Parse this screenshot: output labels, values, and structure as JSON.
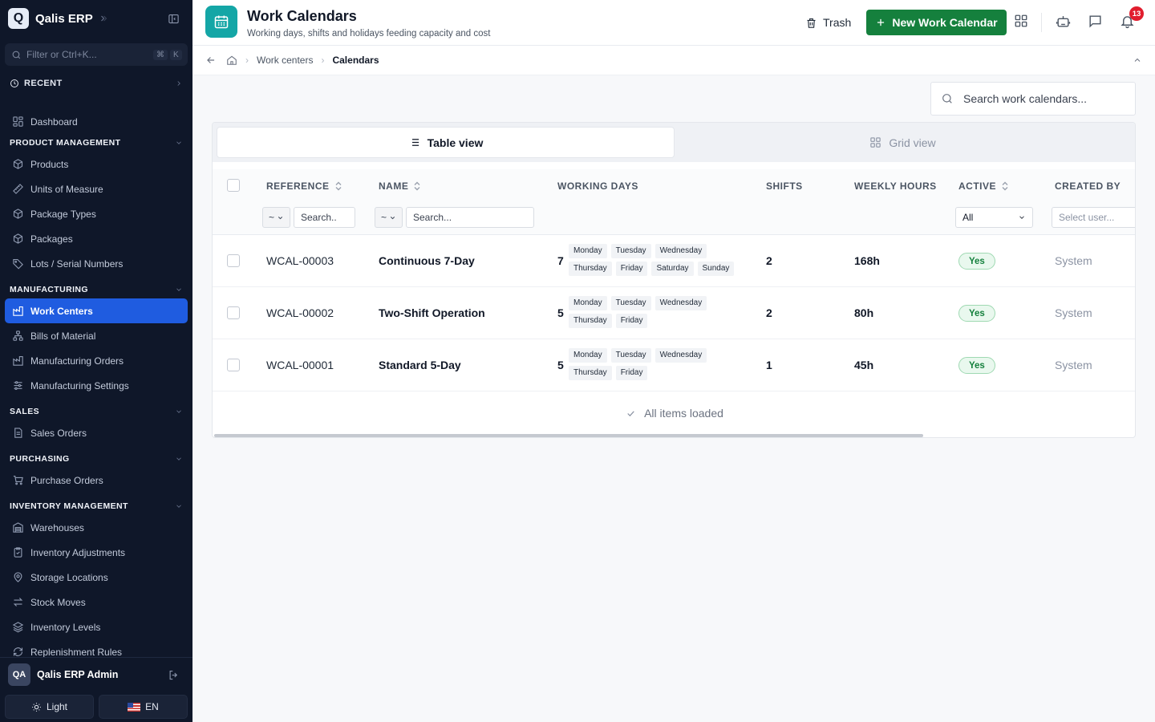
{
  "app": {
    "name": "Qalis ERP",
    "logo_letter": "Q"
  },
  "sidebar": {
    "filter_placeholder": "Filter or Ctrl+K...",
    "filter_keys": [
      "⌘",
      "K"
    ],
    "recent_label": "RECENT",
    "dashboard_label": "Dashboard",
    "sections": [
      {
        "title": "PRODUCT MANAGEMENT",
        "items": [
          "Products",
          "Units of Measure",
          "Package Types",
          "Packages",
          "Lots / Serial Numbers"
        ]
      },
      {
        "title": "MANUFACTURING",
        "items": [
          "Work Centers",
          "Bills of Material",
          "Manufacturing Orders",
          "Manufacturing Settings"
        ]
      },
      {
        "title": "SALES",
        "items": [
          "Sales Orders"
        ]
      },
      {
        "title": "PURCHASING",
        "items": [
          "Purchase Orders"
        ]
      },
      {
        "title": "INVENTORY MANAGEMENT",
        "items": [
          "Warehouses",
          "Inventory Adjustments",
          "Storage Locations",
          "Stock Moves",
          "Inventory Levels",
          "Replenishment Rules"
        ]
      }
    ],
    "active_item": "Work Centers",
    "user": {
      "initials": "QA",
      "name": "Qalis ERP Admin"
    },
    "theme_label": "Light",
    "lang_label": "EN"
  },
  "header": {
    "title": "Work Calendars",
    "subtitle": "Working days, shifts and holidays feeding capacity and cost",
    "trash_label": "Trash",
    "new_label": "New Work Calendar",
    "notification_count": "13"
  },
  "breadcrumb": {
    "items": [
      "Work centers",
      "Calendars"
    ]
  },
  "search": {
    "placeholder": "Search work calendars..."
  },
  "views": {
    "table_label": "Table view",
    "grid_label": "Grid view"
  },
  "table": {
    "columns": [
      "REFERENCE",
      "NAME",
      "WORKING DAYS",
      "SHIFTS",
      "WEEKLY HOURS",
      "ACTIVE",
      "CREATED BY"
    ],
    "filters": {
      "op_symbol": "~",
      "reference_placeholder": "Search..",
      "name_placeholder": "Search...",
      "active_value": "All",
      "created_by_placeholder": "Select user..."
    },
    "rows": [
      {
        "reference": "WCAL-00003",
        "name": "Continuous 7-Day",
        "day_count": "7",
        "days": [
          "Monday",
          "Tuesday",
          "Wednesday",
          "Thursday",
          "Friday",
          "Saturday",
          "Sunday"
        ],
        "shifts": "2",
        "weekly_hours": "168h",
        "active": "Yes",
        "created_by": "System"
      },
      {
        "reference": "WCAL-00002",
        "name": "Two-Shift Operation",
        "day_count": "5",
        "days": [
          "Monday",
          "Tuesday",
          "Wednesday",
          "Thursday",
          "Friday"
        ],
        "shifts": "2",
        "weekly_hours": "80h",
        "active": "Yes",
        "created_by": "System"
      },
      {
        "reference": "WCAL-00001",
        "name": "Standard 5-Day",
        "day_count": "5",
        "days": [
          "Monday",
          "Tuesday",
          "Wednesday",
          "Thursday",
          "Friday"
        ],
        "shifts": "1",
        "weekly_hours": "45h",
        "active": "Yes",
        "created_by": "System"
      }
    ],
    "footer": "All items loaded"
  },
  "colors": {
    "sidebar_bg": "#0f1729",
    "active_nav": "#1f5ce0",
    "primary_button": "#15803d",
    "header_icon": "#14a6a6",
    "badge": "#e11d2e"
  }
}
